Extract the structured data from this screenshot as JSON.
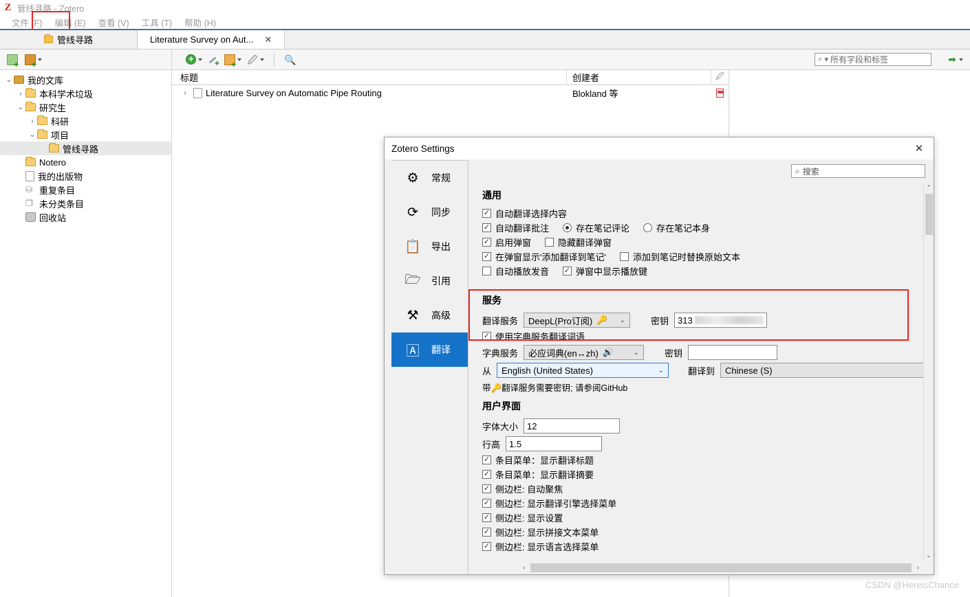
{
  "window": {
    "title": "管线寻路 - Zotero",
    "logo_letter": "Z"
  },
  "menubar": {
    "items": [
      {
        "label": "文件 (F)",
        "name": "menu-file"
      },
      {
        "label": "编辑 (E)",
        "name": "menu-edit"
      },
      {
        "label": "查看 (V)",
        "name": "menu-view"
      },
      {
        "label": "工具 (T)",
        "name": "menu-tools"
      },
      {
        "label": "帮助 (H)",
        "name": "menu-help"
      }
    ]
  },
  "tabs": {
    "library_tab": "管线寻路",
    "doc_tab": "Literature Survey on Aut...",
    "close_glyph": "✕"
  },
  "toolbar": {
    "new_collection_icon": "new-collection-icon",
    "new_library_icon": "new-library-icon",
    "add_item_icon": "add-item-icon",
    "magic_wand_icon": "magic-wand-icon",
    "new_note_icon": "new-note-icon",
    "attachment_icon": "attachment-icon",
    "advanced_search_icon": "advanced-search-icon",
    "search_placeholder": "所有字段和标签",
    "search_magnifier": "⌕",
    "search_caret": "▾",
    "locate_arrow": "➡"
  },
  "collections": {
    "items": [
      {
        "label": "我的文库",
        "twisty": "⌄",
        "indent": 0,
        "icon": "library-icon",
        "selected": false
      },
      {
        "label": "本科学术垃圾",
        "twisty": "›",
        "indent": 1,
        "icon": "folder-icon",
        "selected": false
      },
      {
        "label": "研究生",
        "twisty": "⌄",
        "indent": 1,
        "icon": "folder-icon",
        "selected": false
      },
      {
        "label": "科研",
        "twisty": "›",
        "indent": 2,
        "icon": "folder-icon",
        "selected": false
      },
      {
        "label": "项目",
        "twisty": "⌄",
        "indent": 2,
        "icon": "folder-icon",
        "selected": false
      },
      {
        "label": "管线寻路",
        "twisty": "",
        "indent": 3,
        "icon": "folder-icon",
        "selected": true
      },
      {
        "label": "Notero",
        "twisty": "",
        "indent": 1,
        "icon": "folder-icon",
        "selected": false
      },
      {
        "label": "我的出版物",
        "twisty": "",
        "indent": 1,
        "icon": "document-icon",
        "selected": false
      },
      {
        "label": "重复条目",
        "twisty": "",
        "indent": 1,
        "icon": "duplicates-icon",
        "selected": false
      },
      {
        "label": "未分类条目",
        "twisty": "",
        "indent": 1,
        "icon": "unfiled-icon",
        "selected": false
      },
      {
        "label": "回收站",
        "twisty": "",
        "indent": 1,
        "icon": "trash-icon",
        "selected": false
      }
    ]
  },
  "items_pane": {
    "columns": {
      "title": "标题",
      "creator": "创建者",
      "attachment_icon": "paperclip-icon"
    },
    "rows": [
      {
        "twisty": "›",
        "title": "Literature Survey on Automatic Pipe Routing",
        "creator": "Blokland 等",
        "attachment": "pdf-icon"
      }
    ]
  },
  "settings": {
    "title": "Zotero Settings",
    "close_glyph": "✕",
    "search_placeholder": "搜索",
    "search_magnifier": "⌕",
    "nav": [
      {
        "label": "常规",
        "icon": "gear-icon",
        "glyph": "⚙",
        "selected": false
      },
      {
        "label": "同步",
        "icon": "sync-icon",
        "glyph": "⟳",
        "selected": false
      },
      {
        "label": "导出",
        "icon": "clipboard-icon",
        "glyph": "📋",
        "selected": false
      },
      {
        "label": "引用",
        "icon": "folder-open-icon",
        "glyph": "🗁",
        "selected": false
      },
      {
        "label": "高级",
        "icon": "tools-icon",
        "glyph": "⚒",
        "selected": false
      },
      {
        "label": "翻译",
        "icon": "translate-icon",
        "glyph": "🄰",
        "selected": true
      }
    ],
    "general": {
      "heading": "通用",
      "cb_auto_translate_selection": {
        "label": "自动翻译选择内容",
        "checked": true
      },
      "cb_auto_translate_annotation": {
        "label": "自动翻译批注",
        "checked": true
      },
      "radio_in_note_comment": {
        "label": "存在笔记评论",
        "selected": true
      },
      "radio_in_note_itself": {
        "label": "存在笔记本身",
        "selected": false
      },
      "cb_enable_popup": {
        "label": "启用弹窗",
        "checked": true
      },
      "cb_hide_popup": {
        "label": "隐藏翻译弹窗",
        "checked": false
      },
      "cb_show_add_to_note": {
        "label": "在弹窗显示'添加翻译到笔记'",
        "checked": true
      },
      "cb_replace_original": {
        "label": "添加到笔记时替换原始文本",
        "checked": false
      },
      "cb_auto_play_audio": {
        "label": "自动播放发音",
        "checked": false
      },
      "cb_show_play_button": {
        "label": "弹窗中显示播放键",
        "checked": true
      }
    },
    "service": {
      "heading": "服务",
      "translate_service_label": "翻译服务",
      "translate_service_value": "DeepL(Pro订阅)",
      "translate_service_key_glyph": "🔑",
      "secret_label_1": "密钥",
      "secret_value_1": "313",
      "cb_use_dict_service": {
        "label": "使用字典服务翻译词语",
        "checked": true
      },
      "dict_service_label": "字典服务",
      "dict_service_value": "必应词典(en↔zh)",
      "dict_service_audio_glyph": "🔊",
      "secret_label_2": "密钥",
      "secret_value_2": "",
      "from_label": "从",
      "from_value": "English (United States)",
      "to_label": "翻译到",
      "to_value": "Chinese (S)",
      "hint": "带🔑翻译服务需要密钥; 请参阅GitHub"
    },
    "ui": {
      "heading": "用户界面",
      "font_size_label": "字体大小",
      "font_size_value": "12",
      "line_height_label": "行高",
      "line_height_value": "1.5",
      "checkboxes": [
        {
          "label": "条目菜单：显示翻译标题",
          "checked": true
        },
        {
          "label": "条目菜单：显示翻译摘要",
          "checked": true
        },
        {
          "label": "侧边栏: 自动聚焦",
          "checked": true
        },
        {
          "label": "侧边栏: 显示翻译引擎选择菜单",
          "checked": true
        },
        {
          "label": "侧边栏: 显示设置",
          "checked": true
        },
        {
          "label": "侧边栏: 显示拼接文本菜单",
          "checked": true
        },
        {
          "label": "侧边栏: 显示语言选择菜单",
          "checked": true
        }
      ]
    },
    "scroll": {
      "up_glyph": "⌃",
      "down_glyph": "⌄",
      "left_glyph": "‹",
      "right_glyph": "›"
    }
  },
  "annotations": {
    "highlight_color": "#ee2222"
  },
  "watermark": "CSDN @HereisChance"
}
